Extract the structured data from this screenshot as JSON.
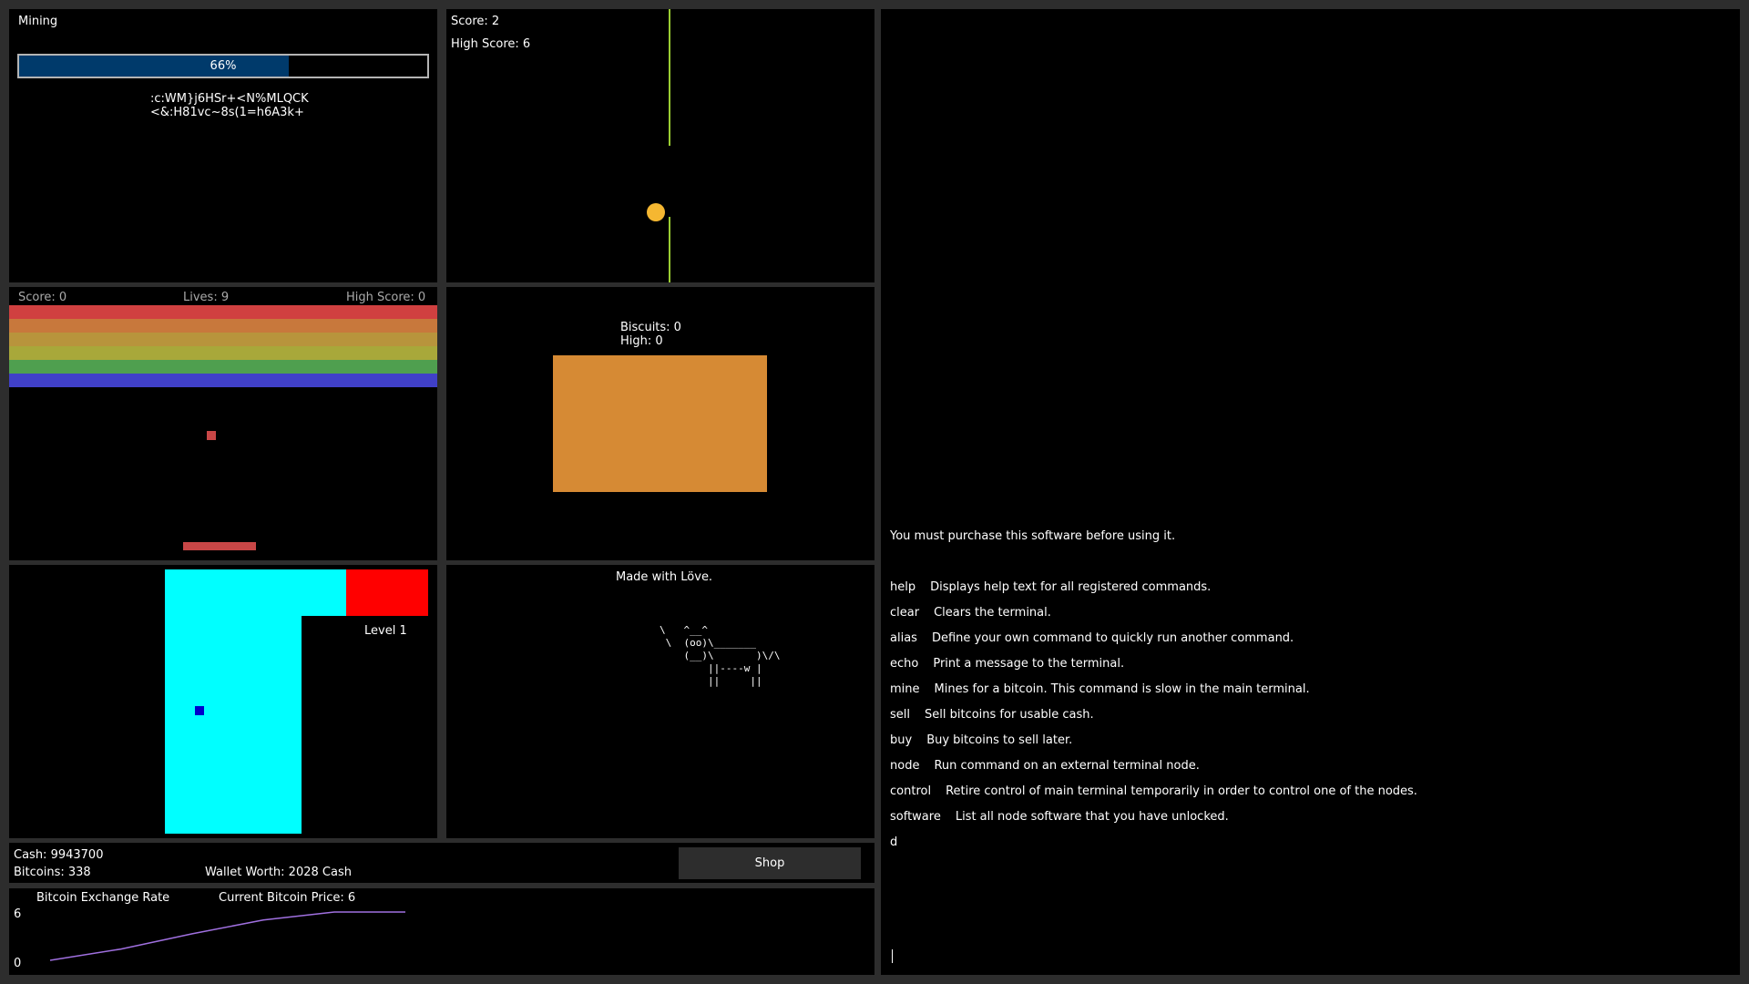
{
  "mining": {
    "title": "Mining",
    "progress_label": "66%",
    "progress_fraction": 0.66,
    "hash_line_1": ":c:WM}j6HSr+<N%MLQCK",
    "hash_line_2": "<&:H81vc~8s(1=h6A3k+",
    "bar_color": "#003a6b"
  },
  "pong": {
    "score": "Score: 2",
    "high_score": "High Score: 6",
    "ball_color": "#f5b731",
    "paddle_color": "#9acd32"
  },
  "breakout": {
    "score": "Score: 0",
    "lives": "Lives: 9",
    "high_score": "High Score: 0",
    "brick_colors": [
      "#d04040",
      "#c8783c",
      "#b8943c",
      "#a8a83a",
      "#4f9f4f",
      "#4040c8"
    ],
    "ball_color": "#c84646",
    "paddle_color": "#c84646"
  },
  "biscuits": {
    "count": "Biscuits: 0",
    "high": "High: 0",
    "biscuit_color": "#d68a34"
  },
  "maze": {
    "level": "Level 1",
    "path_color": "#00ffff",
    "goal_color": "#ff0000",
    "player_color": "#0000cc"
  },
  "love": {
    "title": "Made with Löve.",
    "ascii_art": "\\   ^__^\n \\  (oo)\\_______\n    (__)\\       )\\/\\\n        ||----w |\n        ||     ||"
  },
  "wallet": {
    "cash": "Cash: 9943700",
    "bitcoins": "Bitcoins: 338",
    "wallet_worth": "Wallet Worth: 2028 Cash",
    "shop_label": "Shop"
  },
  "exchange": {
    "title": "Bitcoin Exchange Rate",
    "current_price": "Current Bitcoin Price: 6",
    "y_max_label": "6",
    "y_min_label": "0",
    "line_color": "#a070e0",
    "chart_data": {
      "type": "line",
      "x": [
        0,
        1,
        2,
        3,
        4,
        5
      ],
      "values": [
        0,
        1.4,
        3.3,
        5.0,
        6.0,
        6.0
      ],
      "ylim": [
        0,
        6
      ]
    }
  },
  "terminal": {
    "message": "You must purchase this software before using it.",
    "commands": [
      {
        "name": "help",
        "desc": "Displays help text for all registered commands."
      },
      {
        "name": "clear",
        "desc": "Clears the terminal."
      },
      {
        "name": "alias",
        "desc": "Define your own command to quickly run another command."
      },
      {
        "name": "echo",
        "desc": "Print a message to the terminal."
      },
      {
        "name": "mine",
        "desc": "Mines for a bitcoin. This command is slow in the main terminal."
      },
      {
        "name": "sell",
        "desc": "Sell bitcoins for usable cash."
      },
      {
        "name": "buy",
        "desc": "Buy bitcoins to sell later."
      },
      {
        "name": "node",
        "desc": "Run command on an external terminal node."
      },
      {
        "name": "control",
        "desc": "Retire control of main terminal temporarily in order to control one of the nodes."
      },
      {
        "name": "software",
        "desc": "List all node software that you have unlocked."
      }
    ],
    "last_line": "d",
    "input_value": ""
  }
}
